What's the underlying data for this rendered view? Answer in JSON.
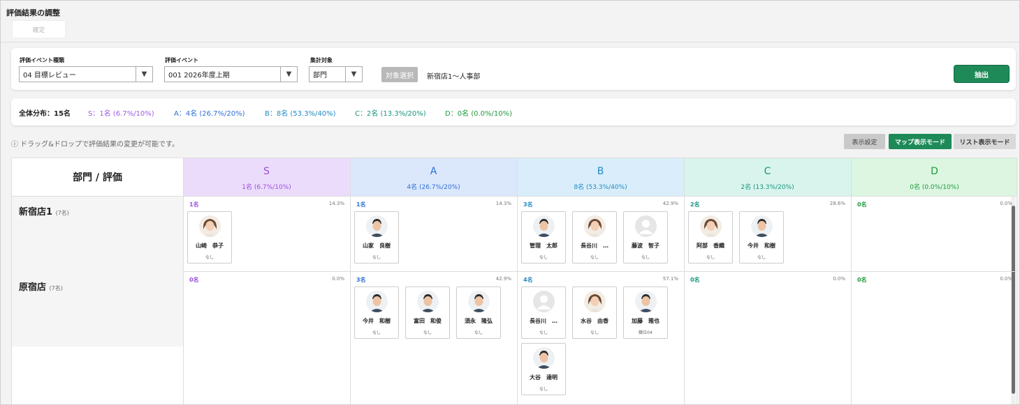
{
  "page_title": "評価結果の調整",
  "confirm_label": "確定",
  "filters": {
    "event_type": {
      "label": "評価イベント種類",
      "value": "04 目標レビュー"
    },
    "event": {
      "label": "評価イベント",
      "value": "001 2026年度上期"
    },
    "target": {
      "label": "集計対象",
      "value": "部門"
    },
    "target_select_label": "対象選択",
    "target_value": "新宿店1～人事部",
    "extract_label": "抽出"
  },
  "summary": {
    "total": "全体分布：15名",
    "items": [
      {
        "text": "S：1名 (6.7%/10%)",
        "color": "#a05be0"
      },
      {
        "text": "A：4名 (26.7%/20%)",
        "color": "#2e6fd6"
      },
      {
        "text": "B：8名 (53.3%/40%)",
        "color": "#2389c2"
      },
      {
        "text": "C：2名 (13.3%/20%)",
        "color": "#16957e"
      },
      {
        "text": "D：0名 (0.0%/10%)",
        "color": "#1f9a3d"
      }
    ]
  },
  "info_note": "ⓘ ドラッグ&ドロップで評価結果の変更が可能です。",
  "toolbar": {
    "display_settings": "表示設定",
    "map_mode": "マップ表示モード",
    "list_mode": "リスト表示モード"
  },
  "grid": {
    "corner_label": "部門 / 評価",
    "grades": [
      {
        "grade": "S",
        "count": "1名 (6.7%/10%)",
        "bg": "#ecdcfb",
        "color": "#9a4fe0"
      },
      {
        "grade": "A",
        "count": "4名 (26.7%/20%)",
        "bg": "#dbe8fb",
        "color": "#2e6fd6"
      },
      {
        "grade": "B",
        "count": "8名 (53.3%/40%)",
        "bg": "#d9eefa",
        "color": "#2389c2"
      },
      {
        "grade": "C",
        "count": "2名 (13.3%/20%)",
        "bg": "#d8f4ec",
        "color": "#16957e"
      },
      {
        "grade": "D",
        "count": "0名 (0.0%/10%)",
        "bg": "#dcf6e1",
        "color": "#1f9a3d"
      }
    ],
    "rows": [
      {
        "dept": "新宿店1",
        "members": "(7名)",
        "cells": [
          {
            "count": "1名",
            "pct": "14.3%",
            "people": [
              {
                "name": "山崎　恭子",
                "sub": "なし",
                "avatar": "female"
              }
            ]
          },
          {
            "count": "1名",
            "pct": "14.3%",
            "people": [
              {
                "name": "山家　良樹",
                "sub": "なし",
                "avatar": "male"
              }
            ]
          },
          {
            "count": "3名",
            "pct": "42.9%",
            "people": [
              {
                "name": "管理　太郎",
                "sub": "なし",
                "avatar": "male"
              },
              {
                "name": "長谷川　…",
                "sub": "なし",
                "avatar": "female"
              },
              {
                "name": "藤波　智子",
                "sub": "なし",
                "avatar": "placeholder"
              }
            ]
          },
          {
            "count": "2名",
            "pct": "28.6%",
            "people": [
              {
                "name": "阿部　香織",
                "sub": "なし",
                "avatar": "female"
              },
              {
                "name": "今井　和樹",
                "sub": "なし",
                "avatar": "male"
              }
            ]
          },
          {
            "count": "0名",
            "pct": "0.0%",
            "people": []
          }
        ]
      },
      {
        "dept": "原宿店",
        "members": "(7名)",
        "cells": [
          {
            "count": "0名",
            "pct": "0.0%",
            "people": []
          },
          {
            "count": "3名",
            "pct": "42.9%",
            "people": [
              {
                "name": "今井　和樹",
                "sub": "なし",
                "avatar": "male"
              },
              {
                "name": "富田　和俊",
                "sub": "なし",
                "avatar": "male"
              },
              {
                "name": "須永　隆弘",
                "sub": "なし",
                "avatar": "male"
              }
            ]
          },
          {
            "count": "4名",
            "pct": "57.1%",
            "people": [
              {
                "name": "長谷川　…",
                "sub": "なし",
                "avatar": "placeholder"
              },
              {
                "name": "水谷　由香",
                "sub": "なし",
                "avatar": "female"
              },
              {
                "name": "加藤　雅也",
                "sub": "職位04",
                "avatar": "male"
              },
              {
                "name": "大谷　達明",
                "sub": "なし",
                "avatar": "male"
              }
            ]
          },
          {
            "count": "0名",
            "pct": "0.0%",
            "people": []
          },
          {
            "count": "0名",
            "pct": "0.0%",
            "people": []
          }
        ]
      }
    ]
  }
}
